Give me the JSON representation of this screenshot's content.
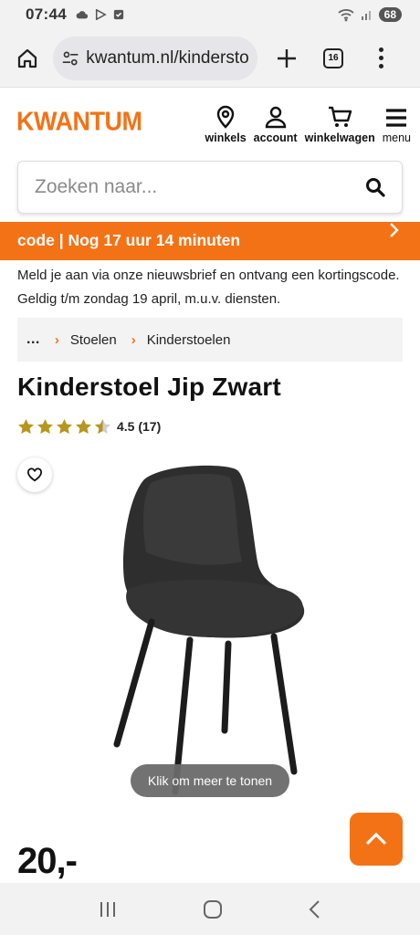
{
  "status_bar": {
    "time": "07:44",
    "battery": "68",
    "icons": [
      "cloud-icon",
      "play-store-icon",
      "checkbox-icon",
      "wifi-icon",
      "signal-icon",
      "battery-icon"
    ]
  },
  "browser": {
    "url": "kwantum.nl/kinderstoelen",
    "tab_count": "16",
    "icons": [
      "home-icon",
      "site-settings-icon",
      "plus-icon",
      "tabs-icon",
      "more-vertical-icon"
    ]
  },
  "header": {
    "logo": "KWANTUM",
    "nav": [
      {
        "label": "winkels",
        "icon": "location-pin-icon"
      },
      {
        "label": "account",
        "icon": "user-icon"
      },
      {
        "label": "winkelwagen",
        "icon": "cart-icon"
      },
      {
        "label": "menu",
        "icon": "hamburger-icon"
      }
    ]
  },
  "search": {
    "placeholder": "Zoeken naar..."
  },
  "promo": {
    "text": "code |   Nog 17 uur 14 minuten"
  },
  "newsletter": {
    "text": "Meld je aan via onze nieuwsbrief en ontvang een kortingscode. Geldig t/m zondag 19 april, m.u.v. diensten."
  },
  "breadcrumb": {
    "ellipsis": "...",
    "items": [
      "Stoelen",
      "Kinderstoelen"
    ]
  },
  "product": {
    "title": "Kinderstoel Jip Zwart",
    "rating": 4.5,
    "rating_text": "4.5 (17)",
    "tooltip": "Klik om meer te tonen",
    "price": "20,-"
  },
  "colors": {
    "brand_orange": "#f47216",
    "star_gold": "#b8961e",
    "chair": "#2b2b2b"
  }
}
